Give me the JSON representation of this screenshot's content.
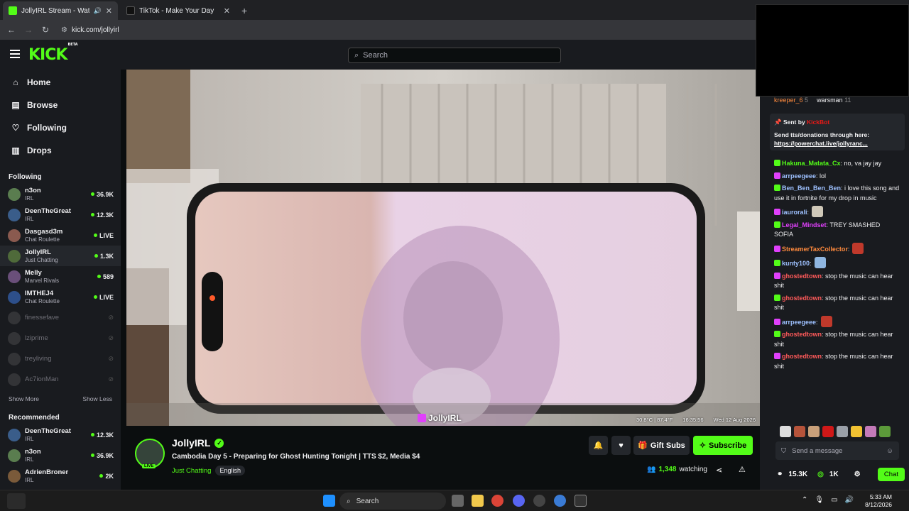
{
  "browser": {
    "tabs": [
      {
        "title": "JollyIRL Stream - Watch Live",
        "active": true
      },
      {
        "title": "TikTok - Make Your Day",
        "active": false
      }
    ],
    "url": "kick.com/jollyirl"
  },
  "kick": {
    "logo": "KICK",
    "logo_suffix": "BETA",
    "search_placeholder": "Search"
  },
  "sidebar": {
    "nav": [
      {
        "label": "Home",
        "icon": "home-icon"
      },
      {
        "label": "Browse",
        "icon": "browse-icon"
      },
      {
        "label": "Following",
        "icon": "heart-icon"
      },
      {
        "label": "Drops",
        "icon": "drops-icon"
      }
    ],
    "following_heading": "Following",
    "following": [
      {
        "name": "n3on",
        "category": "IRL",
        "viewers": "36.9K",
        "color": "#5a7d4f"
      },
      {
        "name": "DeenTheGreat",
        "category": "IRL",
        "viewers": "12.3K",
        "color": "#3a5d8a"
      },
      {
        "name": "Dasgasd3m",
        "category": "Chat Roulette",
        "viewers": "LIVE",
        "color": "#8a5a4f"
      },
      {
        "name": "JollyIRL",
        "category": "Just Chatting",
        "viewers": "1.3K",
        "color": "#4f6a3a"
      },
      {
        "name": "Melly",
        "category": "Marvel Rivals",
        "viewers": "589",
        "color": "#6a4f7a"
      },
      {
        "name": "IMTHEJ4",
        "category": "Chat Roulette",
        "viewers": "LIVE",
        "color": "#2d4f8a"
      }
    ],
    "offline": [
      {
        "name": "finessefave"
      },
      {
        "name": "lziprime"
      },
      {
        "name": "treyliving"
      },
      {
        "name": "Ac7ionMan"
      }
    ],
    "show_more": "Show More",
    "show_less": "Show Less",
    "recommended_heading": "Recommended",
    "recommended": [
      {
        "name": "DeenTheGreat",
        "category": "IRL",
        "viewers": "12.3K",
        "color": "#3a5d8a"
      },
      {
        "name": "n3on",
        "category": "IRL",
        "viewers": "36.9K",
        "color": "#5a7d4f"
      },
      {
        "name": "AdrienBroner",
        "category": "IRL",
        "viewers": "2K",
        "color": "#7a5a3a"
      }
    ]
  },
  "player": {
    "overlay_temp": "30.8°C | 87.4°F",
    "overlay_time": "16:35:56",
    "overlay_date": "Wed 12 Aug 2026",
    "watermark": "JollyIRL"
  },
  "stream": {
    "streamer": "JollyIRL",
    "live_label": "LIVE",
    "title": "Cambodia Day 5 - Preparing for Ghost Hunting Tonight | TTS $2, Media $4",
    "category": "Just Chatting",
    "language": "English",
    "gift_label": "Gift Subs",
    "subscribe_label": "Subscribe",
    "viewers": "1,348",
    "watching_label": "watching"
  },
  "chat": {
    "leaderboard": [
      {
        "user": "kreeper_6",
        "count": "5"
      },
      {
        "user": "warsman",
        "count": "11"
      }
    ],
    "pinned": {
      "sent_by_label": "Sent by",
      "sender": "KickBot",
      "message": "Send tts/donations through here:",
      "link": "https://powerchat.live/jollyranc..."
    },
    "messages": [
      {
        "user": "Hakuna_Matata_Cx",
        "color": "#53fc18",
        "text": ": no, va jay jay"
      },
      {
        "user": "arrpeegeee",
        "color": "#9ec1ff",
        "text": ": lol"
      },
      {
        "user": "Ben_Ben_Ben_Ben",
        "color": "#9ec1ff",
        "text": ": i love this song and use it in fortnite for my drop in music"
      },
      {
        "user": "iaurorali",
        "color": "#9ec1ff",
        "text": ":"
      },
      {
        "user": "Legal_Mindset",
        "color": "#e040fb",
        "text": ": TREY SMASHED SOFIA"
      },
      {
        "user": "StreamerTaxCollector",
        "color": "#ff8a3d",
        "text": ":"
      },
      {
        "user": "kunty100",
        "color": "#9ec1ff",
        "text": ":"
      },
      {
        "user": "ghostedtown",
        "color": "#ff5a5a",
        "text": ": stop the music can hear shit"
      },
      {
        "user": "ghostedtown",
        "color": "#ff5a5a",
        "text": ": stop the music can hear shit"
      },
      {
        "user": "arrpeegeee",
        "color": "#9ec1ff",
        "text": ":"
      },
      {
        "user": "ghostedtown",
        "color": "#ff5a5a",
        "text": ": stop the music can hear shit"
      },
      {
        "user": "ghostedtown",
        "color": "#ff5a5a",
        "text": ": stop the music can hear shit"
      }
    ],
    "input_placeholder": "Send a message",
    "followers": "15.3K",
    "kicks": "1K",
    "chat_button": "Chat"
  },
  "taskbar": {
    "search_label": "Search",
    "time": "5:33 AM",
    "date": "8/12/2026"
  },
  "colors": {
    "accent": "#53fc18",
    "bg": "#0b0e0f",
    "panel": "#191b1f"
  }
}
